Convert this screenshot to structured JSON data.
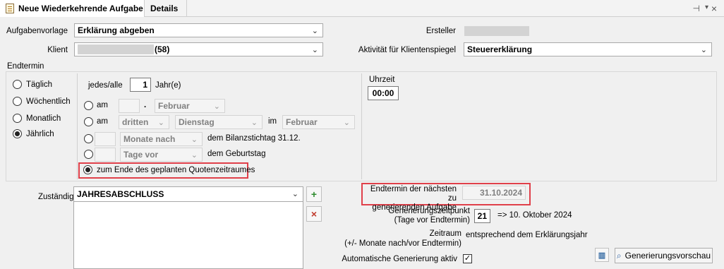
{
  "tabs": [
    {
      "label": "Neue Wiederkehrende Aufgabe"
    },
    {
      "label": "Details"
    }
  ],
  "window_icons": {
    "pin": "pin-icon",
    "menu": "chevron-down-icon",
    "close": "close-icon"
  },
  "form": {
    "aufgabenvorlage_label": "Aufgabenvorlage",
    "aufgabenvorlage_value": "Erklärung abgeben",
    "klient_label": "Klient",
    "klient_value": "(58)",
    "ersteller_label": "Ersteller",
    "aktivitaet_label": "Aktivität für Klientenspiegel",
    "aktivitaet_value": "Steuererklärung"
  },
  "endtermin": {
    "group_label": "Endtermin",
    "frequencies": [
      {
        "label": "Täglich",
        "selected": false
      },
      {
        "label": "Wöchentlich",
        "selected": false
      },
      {
        "label": "Monatlich",
        "selected": false
      },
      {
        "label": "Jährlich",
        "selected": true
      }
    ],
    "jedes_label": "jedes/alle",
    "jedes_value": "1",
    "jahr_label": "Jahr(e)",
    "row_am1": {
      "label": "am",
      "dot": ".",
      "month": "Februar"
    },
    "row_am2": {
      "label": "am",
      "ordinal": "dritten",
      "weekday": "Dienstag",
      "im_label": "im",
      "month": "Februar"
    },
    "row_bilanz": {
      "unit": "Monate nach",
      "text": "dem Bilanzstichtag 31.12."
    },
    "row_geburtstag": {
      "unit": "Tage vor",
      "text": "dem Geburtstag"
    },
    "row_quotenzeitraum": {
      "label": "zum Ende des geplanten Quotenzeitraumes",
      "selected": true
    },
    "uhrzeit_label": "Uhrzeit",
    "uhrzeit_value": "00:00"
  },
  "zustaendige": {
    "label": "Zuständige",
    "value": "JAHRESABSCHLUSS",
    "add_icon": "add-user-icon",
    "remove_icon": "remove-user-icon"
  },
  "generation": {
    "next_label_line1": "Endtermin der nächsten zu",
    "next_label_line2": "generierenden Aufgabe",
    "next_value": "31.10.2024",
    "zeitpunkt_label_line1": "Generierungszeitpunkt",
    "zeitpunkt_label_line2": "(Tage vor Endtermin)",
    "zeitpunkt_value": "21",
    "zeitpunkt_result": "=> 10. Oktober 2024",
    "zeitraum_label_line1": "Zeitraum",
    "zeitraum_label_line2": "(+/- Monate nach/vor Endtermin)",
    "zeitraum_value": "entsprechend dem Erklärungsjahr",
    "auto_label": "Automatische Generierung aktiv",
    "auto_checked": true,
    "preview_button": "Generierungsvorschau"
  },
  "colors": {
    "highlight_border": "#e0404a",
    "background": "#f0f0f0"
  }
}
